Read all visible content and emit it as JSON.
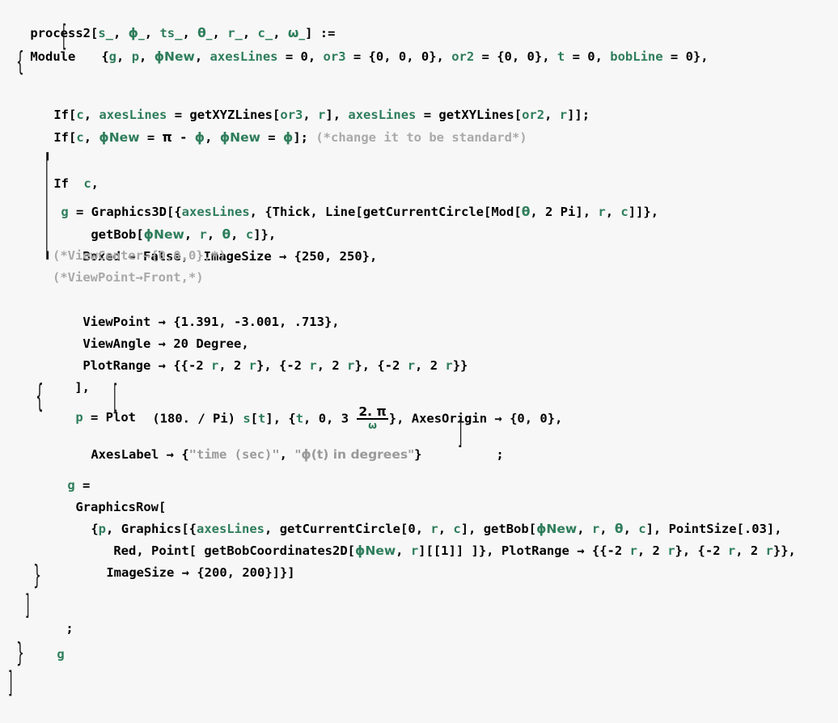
{
  "app": {
    "kind": "mathematica-notebook-code-cell",
    "background_color": "#f7f7f7",
    "symbol_color": "#2e7d5b",
    "builtin_color": "#000000",
    "comment_color": "#a9a9a9",
    "string_color": "#9a9a9a"
  },
  "code": {
    "language": "Wolfram Language",
    "definition_name": "process2",
    "lines": [
      {
        "n": 1,
        "text": "process2[s_, ϕ_, ts_, θ_, r_, c_, ω_] :="
      },
      {
        "n": 2,
        "text": " Module[{g, p, ϕNew, axesLines = 0, or3 = {0, 0, 0}, or2 = {0, 0}, t = 0, bobLine = 0},"
      },
      {
        "n": 3,
        "text": "  {"
      },
      {
        "n": 4,
        "text": "   If[c, axesLines = getXYZLines[or3, r], axesLines = getXYLines[or2, r]];"
      },
      {
        "n": 5,
        "text": "   If[c, ϕNew = π - ϕ, ϕNew = ϕ]; (*change it to be standard*)"
      },
      {
        "n": 6,
        "text": ""
      },
      {
        "n": 7,
        "text": "   If[c,"
      },
      {
        "n": 8,
        "text": "    g = Graphics3D[{axesLines, {Thick, Line[getCurrentCircle[Mod[θ, 2 Pi], r, c]]},"
      },
      {
        "n": 9,
        "text": "       getBob[ϕNew, r, θ, c]},"
      },
      {
        "n": 10,
        "text": "      Boxed → False,  ImageSize → {250, 250},"
      },
      {
        "n": 11,
        "text": "      (*ViewCenter→{0,0,0},*)"
      },
      {
        "n": 12,
        "text": "      (*ViewPoint→Front,*)"
      },
      {
        "n": 13,
        "text": "      ViewPoint → {1.391, -3.001, .713},"
      },
      {
        "n": 14,
        "text": "      ViewAngle → 20 Degree,"
      },
      {
        "n": 15,
        "text": "      PlotRange → {{-2 r, 2 r}, {-2 r, 2 r}, {-2 r, 2 r}}"
      },
      {
        "n": 16,
        "text": "     ],"
      },
      {
        "n": 17,
        "text": "    {p = Plot[(180. / Pi) s[t], {t, 0, 3 (2. π)/ω}, AxesOrigin → {0, 0},"
      },
      {
        "n": 18,
        "text": "      AxesLabel → {\"time (sec)\", \"ϕ(t) in degrees\"}];"
      },
      {
        "n": 19,
        "text": "     g ="
      },
      {
        "n": 20,
        "text": "      GraphicsRow["
      },
      {
        "n": 21,
        "text": "       {p, Graphics[{axesLines, getCurrentCircle[0, r, c], getBob[ϕNew, r, θ, c], PointSize[.03],"
      },
      {
        "n": 22,
        "text": "         Red, Point[ getBobCoordinates2D[ϕNew, r][[1]] ]}, PlotRange → {{-2 r, 2 r}, {-2 r, 2 r}},"
      },
      {
        "n": 23,
        "text": "         ImageSize → {200, 200}]}]"
      },
      {
        "n": 24,
        "text": "    }"
      },
      {
        "n": 25,
        "text": "   ];"
      },
      {
        "n": 26,
        "text": "   g"
      },
      {
        "n": 27,
        "text": "  }"
      },
      {
        "n": 28,
        "text": " ]"
      }
    ]
  },
  "tokens": {
    "l1": {
      "head": "process2",
      "open": "[",
      "p1": "s_",
      "c1": ", ",
      "p2": "ϕ_",
      "c2": ", ",
      "p3": "ts_",
      "c3": ", ",
      "p4": "θ_",
      "c4": ", ",
      "p5": "r_",
      "c5": ", ",
      "p6": "c_",
      "c6": ", ",
      "p7": "ω_",
      "close": "]",
      "assign": " :="
    },
    "l2": {
      "module": "Module",
      "brace_open": "{",
      "g": "g",
      "s1": ", ",
      "p": "p",
      "s2": ", ",
      "phiNew": "ϕNew",
      "s3": ", ",
      "axesLines": "axesLines",
      "eq1": " = ",
      "zero1": "0",
      "s4": ", ",
      "or3": "or3",
      "eq2": " = ",
      "val3": "{0, 0, 0}",
      "s5": ", ",
      "or2": "or2",
      "eq3": " = ",
      "val2": "{0, 0}",
      "s6": ", ",
      "t": "t",
      "eq4": " = ",
      "zero2": "0",
      "s7": ", ",
      "bobLine": "bobLine",
      "eq5": " = ",
      "zero3": "0",
      "brace_close": "},"
    },
    "l3": {
      "brace": "{"
    },
    "l4": {
      "if": "If",
      "ob": "[",
      "c": "c",
      "sep1": ", ",
      "axesLines1": "axesLines",
      "eq1": " = ",
      "fn1": "getXYZLines",
      "ob1": "[",
      "or3": "or3",
      "sep2": ", ",
      "r1": "r",
      "cb1": "]",
      "sep3": ", ",
      "axesLines2": "axesLines",
      "eq2": " = ",
      "fn2": "getXYLines",
      "ob2": "[",
      "or2": "or2",
      "sep4": ", ",
      "r2": "r",
      "cb2": "]",
      "end": "];"
    },
    "l5": {
      "if": "If",
      "ob": "[",
      "c": "c",
      "sep1": ", ",
      "phiNew1": "ϕNew",
      "eq1": " = ",
      "pi": "π",
      "minus": " - ",
      "phi1": "ϕ",
      "sep2": ", ",
      "phiNew2": "ϕNew",
      "eq2": " = ",
      "phi2": "ϕ",
      "end": "];",
      "comment": "(*change it to be standard*)"
    },
    "l7": {
      "if": "If",
      "ob": "[",
      "c": "c",
      "comma": ","
    },
    "l8": {
      "g": "g",
      "eq": " = ",
      "head": "Graphics3D",
      "ob": "[{",
      "axesLines": "axesLines",
      "s1": ", {",
      "thick": "Thick",
      "s2": ", ",
      "line": "Line",
      "ob2": "[",
      "getCurrentCircle": "getCurrentCircle",
      "ob3": "[",
      "mod": "Mod",
      "ob4": "[",
      "theta": "θ",
      "s3": ", ",
      "twopi": "2 Pi",
      "cb1": "]",
      "s4": ", ",
      "r": "r",
      "s5": ", ",
      "c": "c",
      "cb2": "]]},"
    },
    "l9": {
      "getBob": "getBob",
      "ob": "[",
      "phiNew": "ϕNew",
      "s1": ", ",
      "r": "r",
      "s2": ", ",
      "theta": "θ",
      "s3": ", ",
      "c": "c",
      "cb": "]},"
    },
    "l10": {
      "boxed": "Boxed",
      "arrow1": " → ",
      "false": "False",
      "s1": ",  ",
      "imageSize": "ImageSize",
      "arrow2": " → ",
      "val": "{250, 250},"
    },
    "l11": {
      "comment": "(*ViewCenter→{0,0,0},*)"
    },
    "l12": {
      "comment": "(*ViewPoint→Front,*)"
    },
    "l13": {
      "key": "ViewPoint",
      "arrow": " → ",
      "val": "{1.391, -3.001, .713},"
    },
    "l14": {
      "key": "ViewAngle",
      "arrow": " → ",
      "num": "20",
      "sp": " ",
      "degree": "Degree",
      "comma": ","
    },
    "l15": {
      "key": "PlotRange",
      "arrow": " → ",
      "open": "{{-2 ",
      "r1": "r",
      "m1": ", 2 ",
      "r2": "r",
      "m2": "}, {-2 ",
      "r3": "r",
      "m3": ", 2 ",
      "r4": "r",
      "m4": "}, {-2 ",
      "r5": "r",
      "m5": ", 2 ",
      "r6": "r",
      "close": "}}"
    },
    "l16": {
      "text": "],"
    },
    "l17": {
      "brace": "{",
      "p": "p",
      "eq": " = ",
      "plot": "Plot",
      "ob": "[",
      "coef": "(180. / Pi) ",
      "s": "s",
      "ob2": "[",
      "t1": "t",
      "cb2": "]",
      "s1": ", {",
      "t2": "t",
      "s2": ", ",
      "zero": "0",
      "s3": ", ",
      "three": "3 ",
      "frac_num": "2. π",
      "frac_den": "ω",
      "s4": "}, ",
      "axesOrigin": "AxesOrigin",
      "arrow": " → ",
      "val": "{0, 0},"
    },
    "l18": {
      "key": "AxesLabel",
      "arrow": " → ",
      "ob": "{",
      "str1": "\"time (sec)\"",
      "s1": ", ",
      "str2": "\"ϕ(t) in degrees\"",
      "cb": "}",
      "end": ";"
    },
    "l19": {
      "g": "g",
      "eq": " ="
    },
    "l20": {
      "head": "GraphicsRow",
      "ob": "["
    },
    "l21": {
      "ob": "{",
      "p": "p",
      "s1": ", ",
      "graphics": "Graphics",
      "ob2": "[{",
      "axesLines": "axesLines",
      "s2": ", ",
      "getCurrentCircle": "getCurrentCircle",
      "ob3": "[",
      "zero": "0",
      "s3": ", ",
      "r1": "r",
      "s4": ", ",
      "c1": "c",
      "cb1": "], ",
      "getBob": "getBob",
      "ob4": "[",
      "phiNew": "ϕNew",
      "s5": ", ",
      "r2": "r",
      "s6": ", ",
      "theta": "θ",
      "s7": ", ",
      "c2": "c",
      "cb2": "], ",
      "pointSize": "PointSize",
      "ob5": "[",
      "psv": ".03",
      "cb3": "],"
    },
    "l22": {
      "red": "Red",
      "s1": ", ",
      "point": "Point",
      "ob": "[ ",
      "getBobCoordinates2D": "getBobCoordinates2D",
      "ob2": "[",
      "phiNew": "ϕNew",
      "s2": ", ",
      "r1": "r",
      "cb2": "]",
      "part": "[[1]]",
      "cb3": " ]}, ",
      "plotRange": "PlotRange",
      "arrow": " → ",
      "pr1": "{{-2 ",
      "r2": "r",
      "pr2": ", 2 ",
      "r3": "r",
      "pr3": "}, {-2 ",
      "r4": "r",
      "pr4": ", 2 ",
      "r5": "r",
      "pr5": "}},"
    },
    "l23": {
      "key": "ImageSize",
      "arrow": " → ",
      "val": "{200, 200}]}]"
    },
    "l24": {
      "brace": "}"
    },
    "l25": {
      "bracket": "]",
      "semi": ";"
    },
    "l26": {
      "g": "g"
    },
    "l27": {
      "brace": "}"
    },
    "l28": {
      "bracket": "]"
    }
  }
}
